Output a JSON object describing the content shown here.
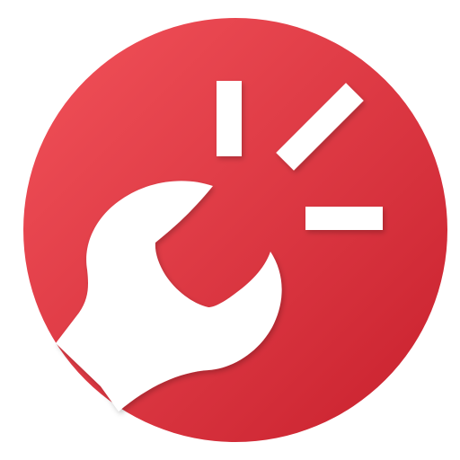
{
  "icon": {
    "name": "wrench-repair-icon",
    "accent_color": "#e33d48",
    "accent_color_light": "#f2525a",
    "accent_color_dark": "#c8202d",
    "glyph_color": "#ffffff"
  }
}
